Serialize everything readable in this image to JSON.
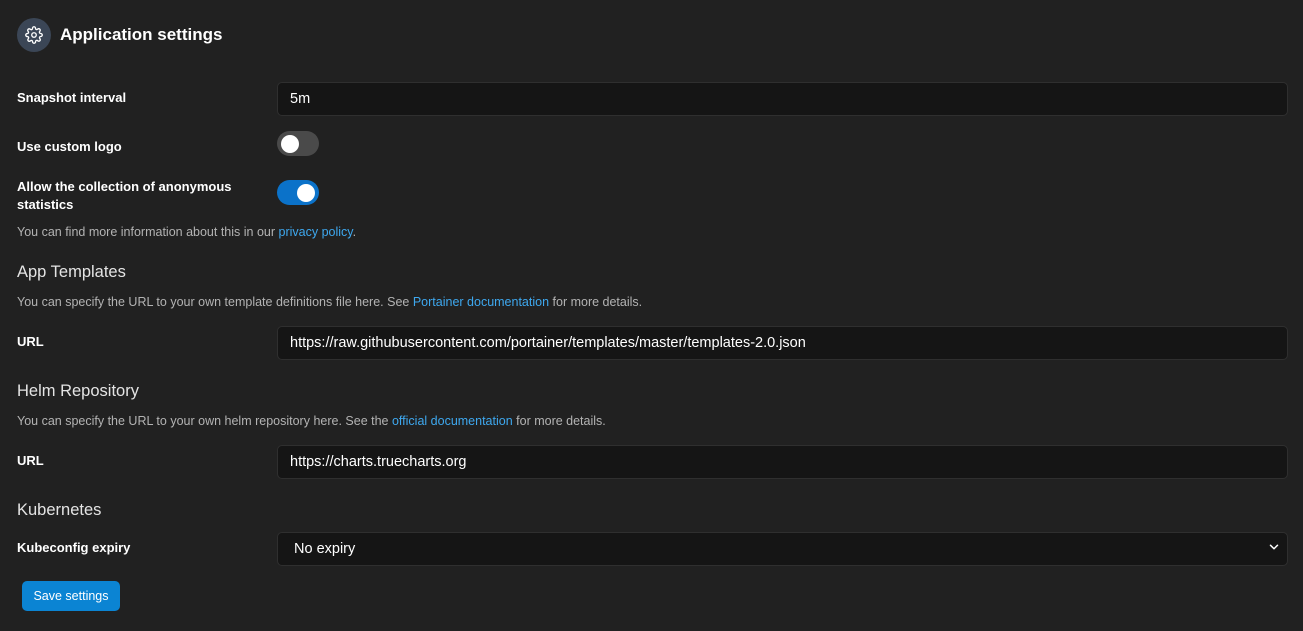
{
  "header": {
    "title": "Application settings",
    "icon": "gear-icon"
  },
  "snapshot": {
    "label": "Snapshot interval",
    "value": "5m"
  },
  "custom_logo": {
    "label": "Use custom logo",
    "enabled": false
  },
  "anonymous_stats": {
    "label_line1": "Allow the collection of anonymous",
    "label_line2": "statistics",
    "enabled": true,
    "help_prefix": "You can find more information about this in our ",
    "help_link": "privacy policy",
    "help_suffix": "."
  },
  "app_templates": {
    "title": "App Templates",
    "help_prefix": "You can specify the URL to your own template definitions file here. See ",
    "help_link": "Portainer documentation",
    "help_suffix": " for more details.",
    "url_label": "URL",
    "url_value": "https://raw.githubusercontent.com/portainer/templates/master/templates-2.0.json"
  },
  "helm": {
    "title": "Helm Repository",
    "help_prefix": "You can specify the URL to your own helm repository here. See the ",
    "help_link": "official documentation",
    "help_suffix": " for more details.",
    "url_label": "URL",
    "url_value": "https://charts.truecharts.org"
  },
  "kubernetes": {
    "title": "Kubernetes",
    "expiry_label": "Kubeconfig expiry",
    "expiry_value": "No expiry"
  },
  "actions": {
    "save_label": "Save settings"
  },
  "colors": {
    "background": "#212121",
    "accent": "#0b84d3",
    "link": "#3ea8ef",
    "toggle_on": "#0b72c9"
  }
}
